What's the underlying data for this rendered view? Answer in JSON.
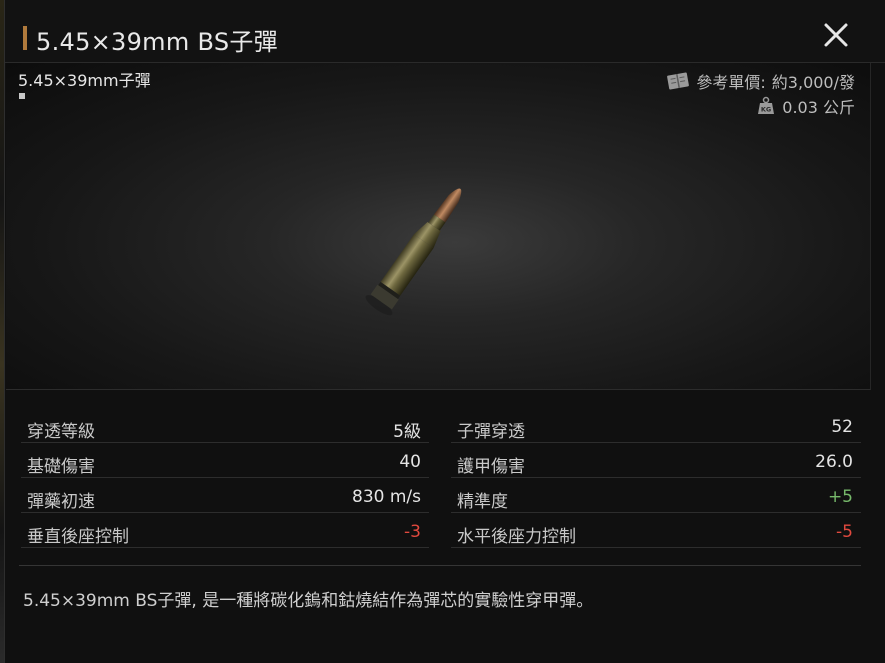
{
  "header": {
    "title": "5.45×39mm BS子彈"
  },
  "preview": {
    "item_name": "5.45×39mm子彈",
    "price_label": "參考單價:",
    "price_value": "約3,000/發",
    "weight": "0.03 公斤",
    "price_icon": "book-icon",
    "weight_icon": "kg-weight-icon"
  },
  "stats": {
    "left": [
      {
        "label": "穿透等級",
        "value": "5級",
        "tone": "normal"
      },
      {
        "label": "基礎傷害",
        "value": "40",
        "tone": "normal"
      },
      {
        "label": "彈藥初速",
        "value": "830 m/s",
        "tone": "normal"
      },
      {
        "label": "垂直後座控制",
        "value": "-3",
        "tone": "negative"
      }
    ],
    "right": [
      {
        "label": "子彈穿透",
        "value": "52",
        "tone": "normal"
      },
      {
        "label": "護甲傷害",
        "value": "26.0",
        "tone": "normal"
      },
      {
        "label": "精準度",
        "value": "+5",
        "tone": "positive"
      },
      {
        "label": "水平後座力控制",
        "value": "-5",
        "tone": "negative"
      }
    ]
  },
  "description": "5.45×39mm BS子彈, 是一種將碳化鎢和鈷燒結作為彈芯的實驗性穿甲彈。",
  "colors": {
    "accent": "#b07a3c",
    "positive": "#76b86a",
    "negative": "#e0493e"
  }
}
